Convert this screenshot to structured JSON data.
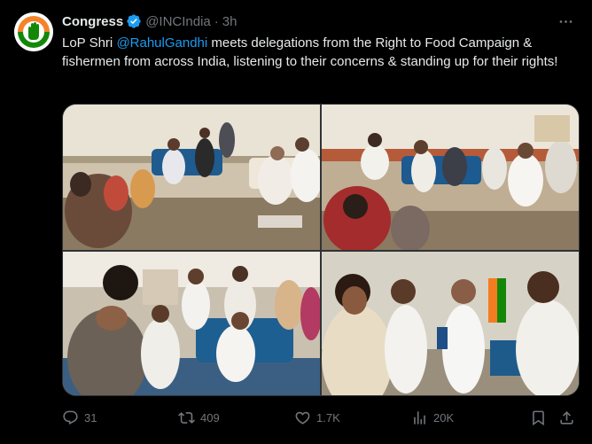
{
  "author": {
    "name": "Congress",
    "handle": "@INCIndia",
    "separator": "·",
    "time": "3h"
  },
  "tweet": {
    "text_before": "LoP Shri ",
    "mention": "@RahulGandhi",
    "text_after": " meets delegations from the Right to Food Campaign & fishermen from across India, listening to their concerns & standing up for their rights!"
  },
  "stats": {
    "replies": "31",
    "reposts": "409",
    "likes": "1.7K",
    "views": "20K"
  },
  "icons": {
    "avatar": "congress-hand-logo",
    "verified": "verified-badge-icon",
    "more": "more-dots-icon",
    "reply": "reply-icon",
    "repost": "repost-icon",
    "like": "heart-icon",
    "views": "views-chart-icon",
    "bookmark": "bookmark-icon",
    "share": "share-icon"
  },
  "colors": {
    "background": "#000000",
    "text": "#e7e9ea",
    "muted": "#71767b",
    "accent": "#1d9bf0",
    "brand_saffron": "#f47c20",
    "brand_green": "#138808"
  }
}
